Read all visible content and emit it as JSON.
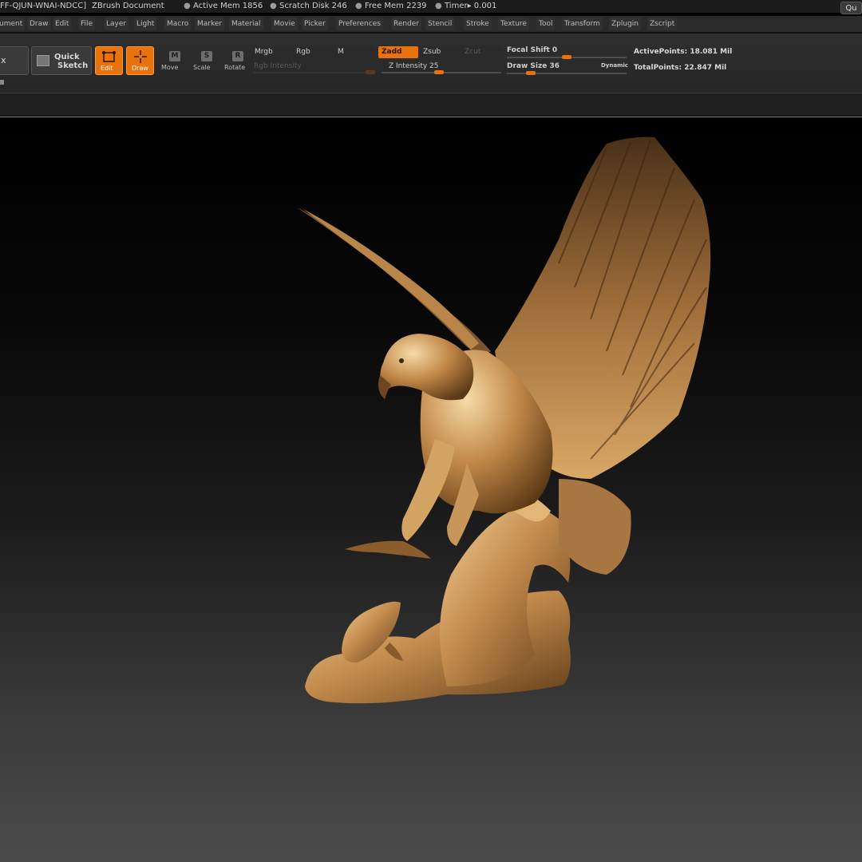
{
  "titlebar": {
    "doc_id": "FF-QJUN-WNAI-NDCC]",
    "doc_name": "ZBrush Document",
    "active_mem": "Active Mem 1856",
    "scratch_disk": "Scratch Disk 246",
    "free_mem": "Free Mem 2239",
    "timer": "Timer▸ 0.001",
    "quick_label": "Qu"
  },
  "menu": [
    "ument",
    "Draw",
    "Edit",
    "File",
    "Layer",
    "Light",
    "Macro",
    "Marker",
    "Material",
    "Movie",
    "Picker",
    "Preferences",
    "Render",
    "Stencil",
    "Stroke",
    "Texture",
    "Tool",
    "Transform",
    "Zplugin",
    "Zscript"
  ],
  "toolbar": {
    "left_label": "x",
    "quick_sketch_line1": "Quick",
    "quick_sketch_line2": "Sketch",
    "edit_label": "Edit",
    "draw_label": "Draw",
    "move_label": "Move",
    "scale_label": "Scale",
    "rotate_label": "Rotate",
    "move_key": "M",
    "scale_key": "S",
    "rotate_key": "R",
    "mrgb": "Mrgb",
    "rgb": "Rgb",
    "m": "M",
    "zadd": "Zadd",
    "zsub": "Zsub",
    "zcut": "Zcut",
    "rgb_intensity": "Rgb Intensity",
    "z_intensity": "Z Intensity 25",
    "focal_shift": "Focal Shift 0",
    "draw_size": "Draw Size 36",
    "dynamic": "Dynamic",
    "active_points": "ActivePoints: 18.081 Mil",
    "total_points": "TotalPoints: 22.847 Mil",
    "z_intensity_value": 25,
    "focal_shift_value": 0,
    "draw_size_value": 36
  },
  "colors": {
    "accent": "#e8720c",
    "bronze_light": "#e0b37a",
    "bronze_dark": "#5a3a18"
  }
}
